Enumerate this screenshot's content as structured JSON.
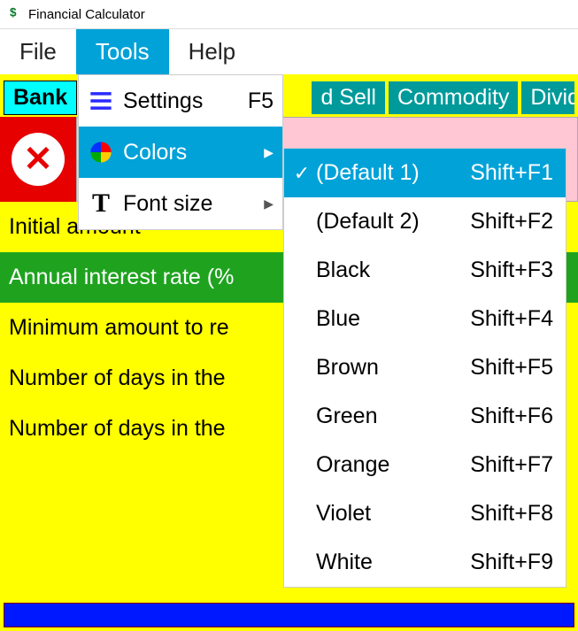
{
  "window": {
    "title": "Financial Calculator"
  },
  "menubar": {
    "items": [
      {
        "label": "File"
      },
      {
        "label": "Tools",
        "active": true
      },
      {
        "label": "Help"
      }
    ]
  },
  "tabs": [
    {
      "label": "Bank",
      "active": true
    },
    {
      "label": "d Sell"
    },
    {
      "label": "Commodity"
    },
    {
      "label": "Divid"
    }
  ],
  "tools_menu": {
    "settings": {
      "label": "Settings",
      "shortcut": "F5"
    },
    "colors": {
      "label": "Colors"
    },
    "fontsize": {
      "label": "Font size"
    }
  },
  "colors_submenu": [
    {
      "label": "(Default 1)",
      "shortcut": "Shift+F1",
      "checked": true,
      "highlight": true
    },
    {
      "label": "(Default 2)",
      "shortcut": "Shift+F2"
    },
    {
      "label": "Black",
      "shortcut": "Shift+F3"
    },
    {
      "label": "Blue",
      "shortcut": "Shift+F4"
    },
    {
      "label": "Brown",
      "shortcut": "Shift+F5"
    },
    {
      "label": "Green",
      "shortcut": "Shift+F6"
    },
    {
      "label": "Orange",
      "shortcut": "Shift+F7"
    },
    {
      "label": "Violet",
      "shortcut": "Shift+F8"
    },
    {
      "label": "White",
      "shortcut": "Shift+F9"
    }
  ],
  "form": {
    "initial_amount": "Initial amount",
    "annual_rate": "Annual interest rate (%",
    "min_amount": "Minimum amount to re",
    "days_period": "Number of days in the",
    "days_year": "Number of days in the"
  }
}
